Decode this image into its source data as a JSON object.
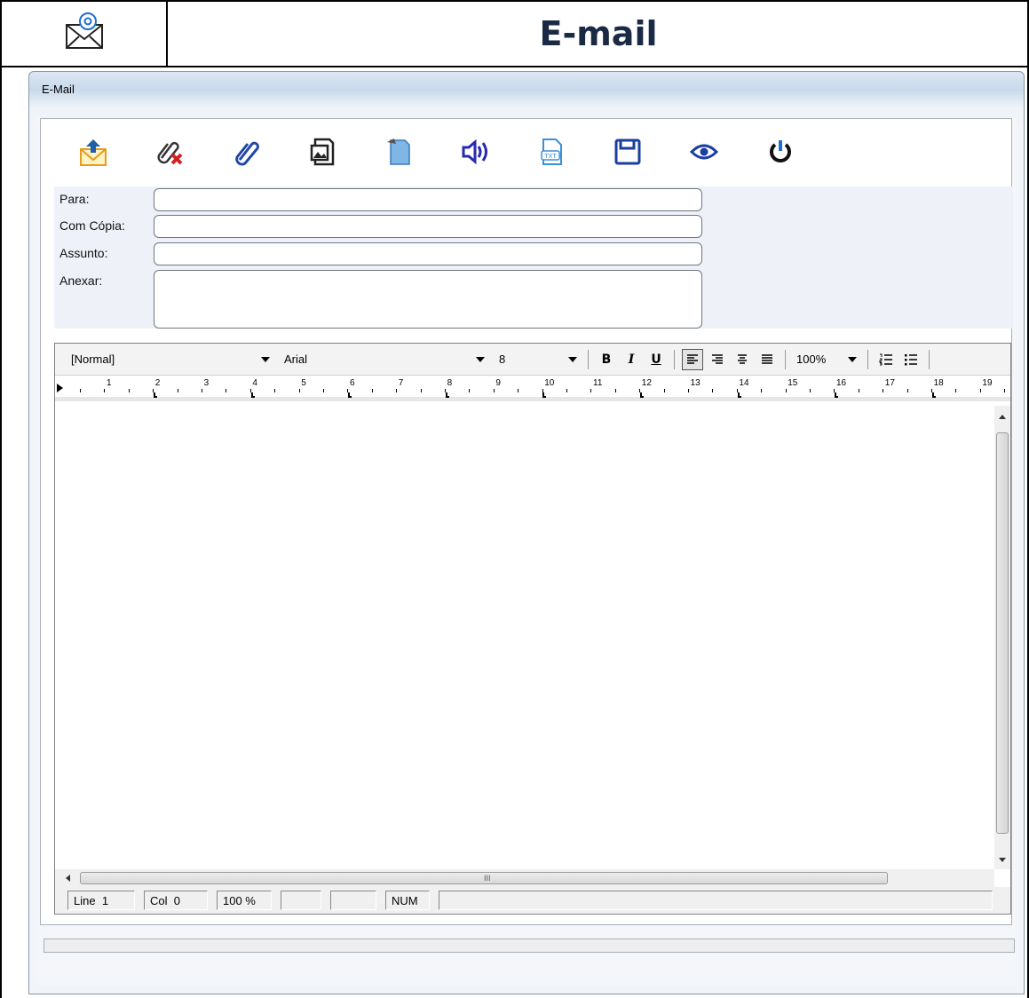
{
  "header": {
    "title": "E-mail",
    "icon": "email-at-icon"
  },
  "window": {
    "title": "E-Mail"
  },
  "toolbar": {
    "buttons": [
      {
        "icon": "send-mail-icon"
      },
      {
        "icon": "remove-attachment-icon"
      },
      {
        "icon": "attach-icon"
      },
      {
        "icon": "insert-image-icon"
      },
      {
        "icon": "document-icon"
      },
      {
        "icon": "speaker-icon"
      },
      {
        "icon": "txt-file-icon"
      },
      {
        "icon": "save-icon"
      },
      {
        "icon": "preview-eye-icon"
      },
      {
        "icon": "power-icon"
      }
    ]
  },
  "form": {
    "to_label": "Para:",
    "cc_label": "Com Cópia:",
    "subject_label": "Assunto:",
    "attach_label": "Anexar:",
    "to_value": "",
    "cc_value": "",
    "subject_value": "",
    "attach_value": ""
  },
  "format_bar": {
    "style": "[Normal]",
    "font": "Arial",
    "size": "8",
    "bold": "B",
    "italic": "I",
    "underline": "U",
    "zoom": "100%"
  },
  "ruler": {
    "numbers": [
      "1",
      "2",
      "3",
      "4",
      "5",
      "6",
      "7",
      "8",
      "9",
      "10",
      "11",
      "12",
      "13",
      "14",
      "15",
      "16",
      "17",
      "18",
      "19"
    ]
  },
  "status_bar": {
    "line_label": "Line",
    "line_value": "1",
    "col_label": "Col",
    "col_value": "0",
    "zoom": "100 %",
    "num": "NUM"
  },
  "hscroll_marker": "III"
}
